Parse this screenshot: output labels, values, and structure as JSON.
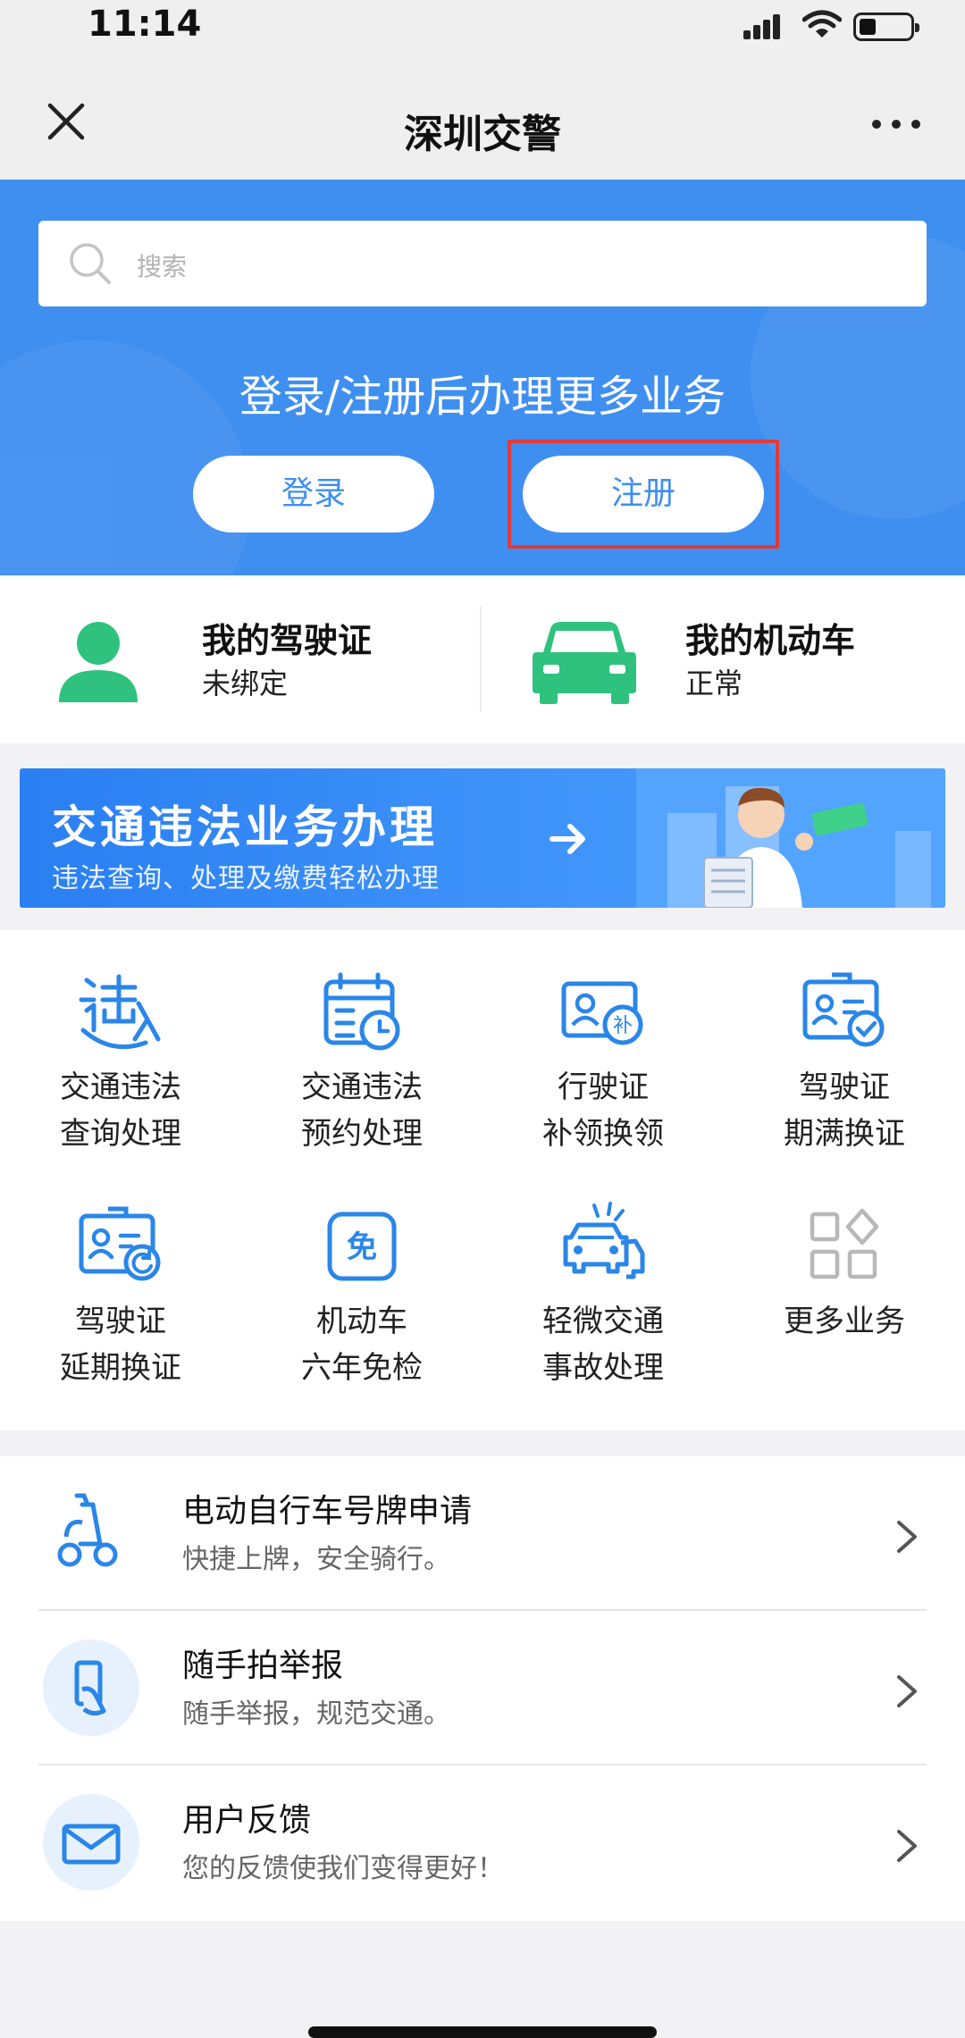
{
  "status_bar": {
    "time": "11:14"
  },
  "navbar": {
    "title": "深圳交警"
  },
  "search": {
    "placeholder": "搜索"
  },
  "hero": {
    "title": "登录/注册后办理更多业务",
    "login_label": "登录",
    "register_label": "注册"
  },
  "cards": [
    {
      "title": "我的驾驶证",
      "status": "未绑定",
      "icon": "person-icon"
    },
    {
      "title": "我的机动车",
      "status": "正常",
      "icon": "car-icon"
    }
  ],
  "banner": {
    "title": "交通违法业务办理",
    "subtitle": "违法查询、处理及缴费轻松办理"
  },
  "services": [
    {
      "line1": "交通违法",
      "line2": "查询处理",
      "icon": "violation-icon"
    },
    {
      "line1": "交通违法",
      "line2": "预约处理",
      "icon": "calendar-clock-icon"
    },
    {
      "line1": "行驶证",
      "line2": "补领换领",
      "icon": "license-replace-icon",
      "badge": "补"
    },
    {
      "line1": "驾驶证",
      "line2": "期满换证",
      "icon": "license-check-icon"
    },
    {
      "line1": "驾驶证",
      "line2": "延期换证",
      "icon": "license-refresh-icon"
    },
    {
      "line1": "机动车",
      "line2": "六年免检",
      "icon": "exempt-icon",
      "badge": "免"
    },
    {
      "line1": "轻微交通",
      "line2": "事故处理",
      "icon": "car-accident-icon"
    },
    {
      "line1": "更多业务",
      "line2": "",
      "icon": "more-grid-icon"
    }
  ],
  "list": [
    {
      "title": "电动自行车号牌申请",
      "subtitle": "快捷上牌，安全骑行。",
      "icon": "scooter-icon"
    },
    {
      "title": "随手拍举报",
      "subtitle": "随手举报，规范交通。",
      "icon": "phone-report-icon"
    },
    {
      "title": "用户反馈",
      "subtitle": "您的反馈使我们变得更好！",
      "icon": "envelope-icon"
    }
  ],
  "colors": {
    "primary": "#3f8ff0",
    "green": "#2ec27e",
    "highlight": "#e23a3a"
  }
}
